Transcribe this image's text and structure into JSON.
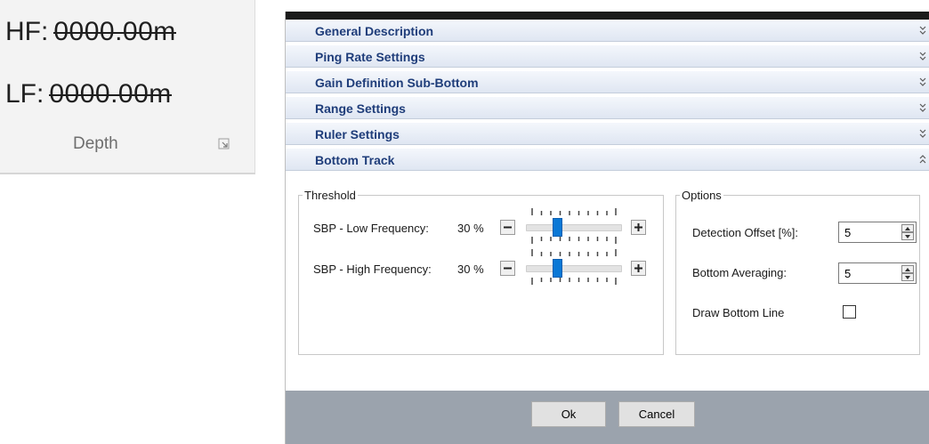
{
  "ribbon": {
    "hf_label": "HF:",
    "hf_value": "0000.00m",
    "lf_label": "LF:",
    "lf_value": "0000.00m",
    "group_caption": "Depth"
  },
  "dialog": {
    "sections": [
      {
        "label": "General Description",
        "state": "collapsed"
      },
      {
        "label": "Ping Rate Settings",
        "state": "collapsed"
      },
      {
        "label": "Gain Definition Sub-Bottom",
        "state": "collapsed"
      },
      {
        "label": "Range Settings",
        "state": "collapsed"
      },
      {
        "label": "Ruler Settings",
        "state": "collapsed"
      },
      {
        "label": "Bottom Track",
        "state": "expanded"
      }
    ],
    "threshold": {
      "legend": "Threshold",
      "sliders": [
        {
          "label": "SBP - Low Frequency:",
          "value_text": "30 %",
          "fraction": 0.3
        },
        {
          "label": "SBP - High Frequency:",
          "value_text": "30 %",
          "fraction": 0.3
        }
      ]
    },
    "options": {
      "legend": "Options",
      "detection_offset_label": "Detection Offset [%]:",
      "detection_offset_value": "5",
      "bottom_averaging_label": "Bottom Averaging:",
      "bottom_averaging_value": "5",
      "draw_bottom_line_label": "Draw Bottom Line",
      "draw_bottom_line_checked": false
    },
    "buttons": {
      "ok": "Ok",
      "cancel": "Cancel"
    },
    "colors": {
      "section_title": "#1f3d7a",
      "slider_thumb": "#0a78d6",
      "footer": "#9ba3ad"
    }
  }
}
